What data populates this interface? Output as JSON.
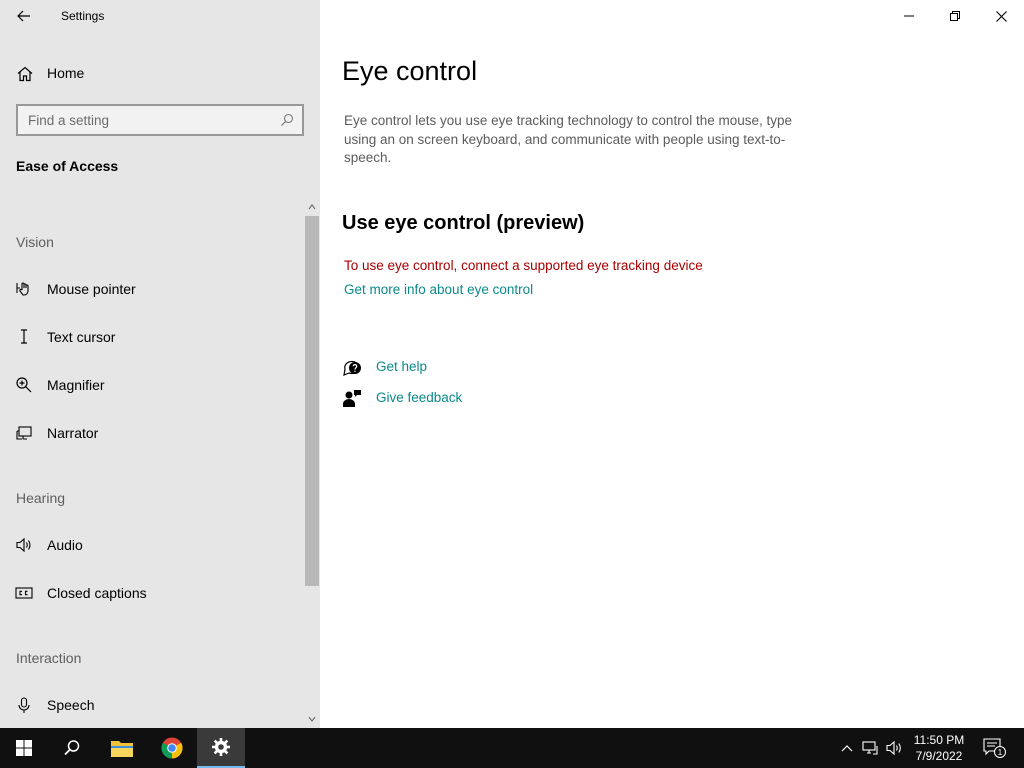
{
  "app": {
    "title": "Settings"
  },
  "sidebar": {
    "home_label": "Home",
    "search_placeholder": "Find a setting",
    "section_title": "Ease of Access",
    "groups": {
      "vision": "Vision",
      "hearing": "Hearing",
      "interaction": "Interaction"
    },
    "items": {
      "mouse_pointer": "Mouse pointer",
      "text_cursor": "Text cursor",
      "magnifier": "Magnifier",
      "narrator": "Narrator",
      "audio": "Audio",
      "closed_captions": "Closed captions",
      "speech": "Speech"
    }
  },
  "main": {
    "title": "Eye control",
    "description": "Eye control lets you use eye tracking technology to control the mouse, type using an on screen keyboard, and communicate with people using text-to-speech.",
    "subtitle": "Use eye control (preview)",
    "error": "To use eye control, connect a supported eye tracking device",
    "more_info_link": "Get more info about eye control",
    "get_help": "Get help",
    "give_feedback": "Give feedback"
  },
  "taskbar": {
    "time": "11:50 PM",
    "date": "7/9/2022",
    "notification_count": "1",
    "accent_color": "#76b9ed"
  },
  "icons": {
    "back": "back-arrow-icon",
    "home": "home-icon",
    "search": "search-icon",
    "mouse_pointer": "mouse-pointer-icon",
    "text_cursor": "text-cursor-icon",
    "magnifier": "magnifier-icon",
    "narrator": "narrator-icon",
    "audio": "speaker-icon",
    "closed_captions": "closed-captions-icon",
    "speech": "microphone-icon"
  },
  "colors": {
    "sidebar_bg": "#e6e6e6",
    "error_text": "#a80000",
    "link": "#0b8a8a"
  }
}
